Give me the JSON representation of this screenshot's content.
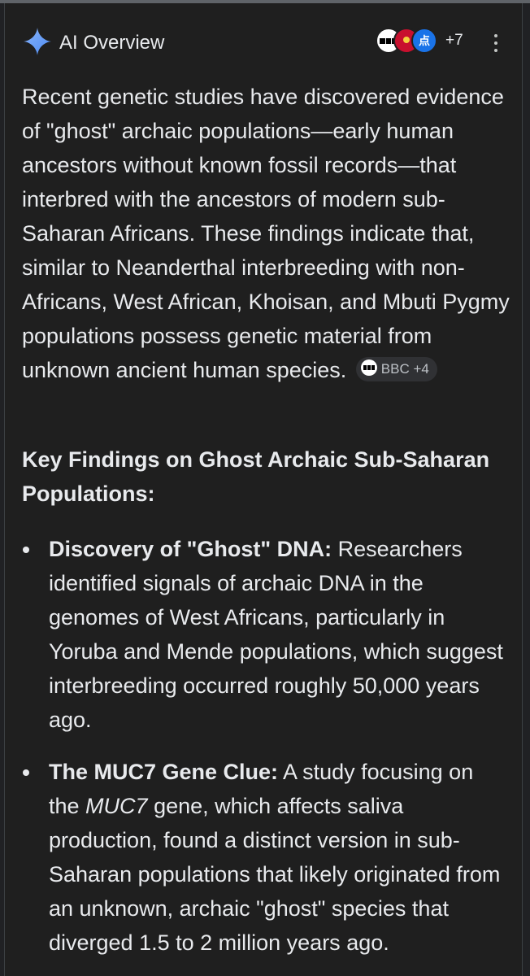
{
  "header": {
    "title": "AI Overview",
    "source_icons": [
      "bbc-logo",
      "source-logo-red",
      "source-logo-blue"
    ],
    "source_icon_three_text": "点",
    "more_sources": "+7",
    "menu_icon": "more-vert-icon"
  },
  "overview": {
    "paragraph": "Recent genetic studies have discovered evidence of \"ghost\" archaic populations—early human ancestors without known fossil records—that interbred with the ancestors of modern sub-Saharan Africans. These findings indicate that, similar to Neanderthal interbreeding with non-Africans, West African, Khoisan, and Mbuti Pygmy populations possess genetic material from unknown ancient human species.",
    "citation_chip": {
      "label": "BBC +4",
      "icon": "bbc-icon"
    }
  },
  "section": {
    "heading": "Key Findings on Ghost Archaic Sub-Saharan Populations:",
    "items": [
      {
        "lead": "Discovery of \"Ghost\" DNA:",
        "text": " Researchers identified signals of archaic DNA in the genomes of West Africans, particularly in Yoruba and Mende populations, which suggest interbreeding occurred roughly 50,000 years ago."
      },
      {
        "lead": "The MUC7 Gene Clue:",
        "text_before": " A study focusing on the ",
        "italic": "MUC7",
        "text_after": " gene, which affects saliva production, found a distinct version in sub-Saharan populations that likely originated from an unknown, archaic \"ghost\" species that diverged 1.5 to 2 million years ago."
      }
    ]
  },
  "colors": {
    "background": "#1f1f1f",
    "text": "#e8eaed",
    "chip_bg": "#303134",
    "sparkle_blue": "#4b8bf5"
  }
}
